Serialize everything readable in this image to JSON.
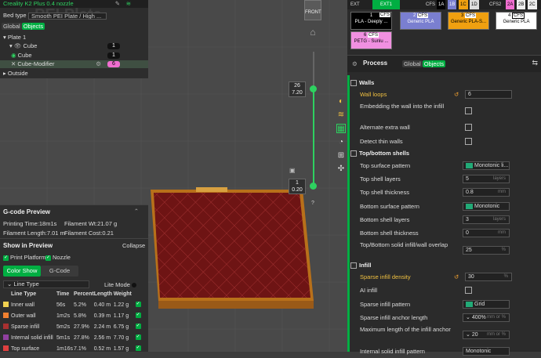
{
  "left_top": {
    "printer": "Creality K2 Plus 0.4 nozzle",
    "bed_type_label": "Bed type",
    "bed_type_value": "Smooth PEI Plate / High ...",
    "tab_global": "Global",
    "tab_objects": "Objects",
    "overlay_text": "PEI Plate",
    "tree": [
      {
        "label": "Plate 1"
      },
      {
        "label": "Cube",
        "count": "1"
      },
      {
        "label": "Cube",
        "count": "1"
      },
      {
        "label": "Cube-Modifier",
        "count": "6"
      },
      {
        "label": "Outside"
      }
    ]
  },
  "viewport": {
    "front_label": "FRONT",
    "slider_top": "26",
    "slider_top_val": "7.20",
    "slider_bot": "1",
    "slider_bot_val": "0.20",
    "qmark": "?"
  },
  "gcode": {
    "title": "G-code Preview",
    "printing_time_label": "Printing Time:",
    "printing_time": "18m1s",
    "filament_wt_label": "Filament Wt:",
    "filament_wt": "21.07 g",
    "filament_len_label": "Filament Length:",
    "filament_len": "7.01 m",
    "filament_cost_label": "Filament Cost:",
    "filament_cost": "0.21",
    "show_title": "Show in Preview",
    "collapse": "Collapse",
    "print_platform": "Print Platform",
    "nozzle": "Nozzle",
    "btn_color": "Color Show",
    "btn_gcode": "G-Code",
    "line_type_select": "Line Type",
    "lite_mode": "Lite Mode",
    "headers": [
      "Line Type",
      "Time",
      "Percent",
      "Length",
      "Weight"
    ],
    "rows": [
      {
        "name": "Inner wall",
        "time": "56s",
        "pct": "5.2%",
        "len": "0.40 m",
        "wt": "1.22 g",
        "color": "#f0d050"
      },
      {
        "name": "Outer wall",
        "time": "1m2s",
        "pct": "5.8%",
        "len": "0.39 m",
        "wt": "1.17 g",
        "color": "#f08030"
      },
      {
        "name": "Sparse infill",
        "time": "5m2s",
        "pct": "27.9%",
        "len": "2.24 m",
        "wt": "6.75 g",
        "color": "#a83030"
      },
      {
        "name": "Internal solid infill",
        "time": "5m1s",
        "pct": "27.8%",
        "len": "2.56 m",
        "wt": "7.70 g",
        "color": "#9040a0"
      },
      {
        "name": "Top surface",
        "time": "1m16s",
        "pct": "7.1%",
        "len": "0.52 m",
        "wt": "1.57 g",
        "color": "#e04040"
      }
    ]
  },
  "filaments": {
    "ext_labels": [
      "EXT",
      "EXT1",
      "CFS",
      "1A",
      "1B",
      "1C",
      "1D",
      "CFS2",
      "2A",
      "2B",
      "2C"
    ],
    "slots": [
      {
        "num": "1",
        "cfs": "CFS",
        "name": "PLA - Deeply ...",
        "bg": "#000000",
        "fg": "#ffffff"
      },
      {
        "num": "2",
        "cfs": "CFS",
        "name": "Generic PLA",
        "bg": "#7a7fd0",
        "fg": "#ffffff"
      },
      {
        "num": "3",
        "cfs": "CFS",
        "name": "Generic PLA-S...",
        "bg": "#f0a010",
        "fg": "#000000"
      },
      {
        "num": "4",
        "cfs": "CFS",
        "name": "Generic PLA",
        "bg": "#ffffff",
        "fg": "#000000"
      },
      {
        "num": "6",
        "cfs": "CFS",
        "name": "PETG - Sunlu ...",
        "bg": "#f090e0",
        "fg": "#000000"
      }
    ]
  },
  "process": {
    "title": "Process",
    "tab_global": "Global",
    "tab_objects": "Objects",
    "walls": "Walls",
    "wall_loops": "Wall loops",
    "wall_loops_val": "6",
    "embed": "Embedding the wall into the infill",
    "alt_extra": "Alternate extra wall",
    "thin": "Detect thin walls",
    "topbottom": "Top/bottom shells",
    "top_pattern": "Top surface pattern",
    "top_pattern_val": "Monotonic li...",
    "top_layers": "Top shell layers",
    "top_layers_val": "5",
    "layers_unit": "layers",
    "top_thick": "Top shell thickness",
    "top_thick_val": "0.8",
    "mm": "mm",
    "bot_pattern": "Bottom surface pattern",
    "bot_pattern_val": "Monotonic",
    "bot_layers": "Bottom shell layers",
    "bot_layers_val": "3",
    "bot_thick": "Bottom shell thickness",
    "bot_thick_val": "0",
    "overlap": "Top/Bottom solid infill/wall overlap",
    "overlap_val": "25",
    "pct": "%",
    "infill": "Infill",
    "density": "Sparse infill density",
    "density_val": "30",
    "ai": "AI infill",
    "sparse_pattern": "Sparse infill pattern",
    "sparse_pattern_val": "Grid",
    "anchor": "Sparse infill anchor length",
    "anchor_val": "400%",
    "anchor_unit": "mm or %",
    "maxlen": "Maximum length of the infill anchor",
    "maxlen_val": "20",
    "internal": "Internal solid infill pattern",
    "internal_val": "Monotonic"
  }
}
